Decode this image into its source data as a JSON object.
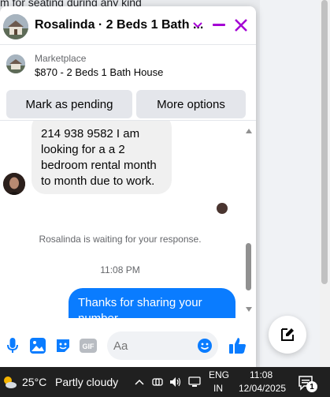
{
  "background": {
    "text": "m for seating during any kind"
  },
  "header": {
    "title": "Rosalinda · 2 Beds 1 Bath ..."
  },
  "marketplace": {
    "label": "Marketplace",
    "title": "$870 - 2 Beds 1 Bath House",
    "pending_button": "Mark as pending",
    "more_button": "More options"
  },
  "messages": {
    "incoming": [
      "214 938 9582 I am",
      "looking for a a 2",
      "bedroom rental month",
      "to month due to work."
    ],
    "waiting": "Rosalinda is waiting for your response.",
    "timestamp": "11:08 PM",
    "outgoing": [
      "Thanks for sharing your",
      "number."
    ]
  },
  "composer": {
    "placeholder": "Aa"
  },
  "taskbar": {
    "temperature": "25°C",
    "condition": "Partly cloudy",
    "lang_line1": "ENG",
    "lang_line2": "IN",
    "time": "11:08",
    "date": "12/04/2025",
    "notification_count": "1"
  },
  "colors": {
    "accent": "#0a7cff",
    "header_icons": "#a400d4",
    "taskbar": "#202020"
  }
}
